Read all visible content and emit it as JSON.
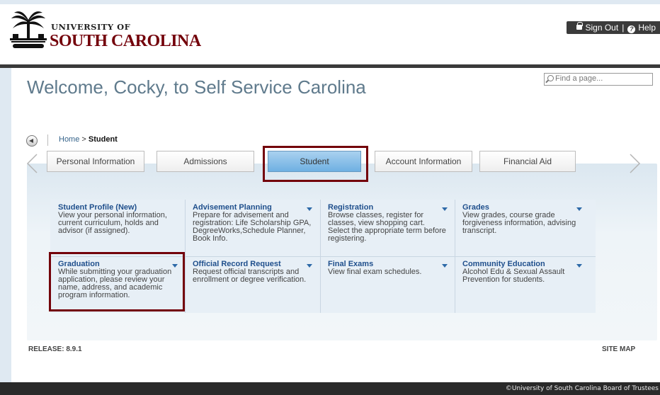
{
  "header": {
    "logo_line1": "UNIVERSITY OF",
    "logo_line2": "SOUTH CAROLINA",
    "sign_out": "Sign Out",
    "separator": "|",
    "help": "Help",
    "icons": [
      "palmetto-seal-icon",
      "lock-icon",
      "help-icon"
    ]
  },
  "page": {
    "welcome": "Welcome, Cocky, to Self Service Carolina",
    "find_placeholder": "Find a page..."
  },
  "breadcrumb": {
    "home": "Home",
    "separator": ">",
    "current": "Student"
  },
  "tabs": [
    {
      "label": "Personal Information"
    },
    {
      "label": "Admissions"
    },
    {
      "label": "Student",
      "active": true
    },
    {
      "label": "Account Information"
    },
    {
      "label": "Financial Aid"
    }
  ],
  "menu": [
    {
      "title": "Student Profile (New)",
      "desc": "View your personal information, current curriculum, holds and advisor (if assigned).",
      "dropdown": false
    },
    {
      "title": "Advisement Planning",
      "desc": "Prepare for advisement and registration: Life Scholarship GPA, DegreeWorks,Schedule Planner, Book Info.",
      "dropdown": true
    },
    {
      "title": "Registration",
      "desc": "Browse classes, register for classes, view shopping cart. Select the appropriate term before registering.",
      "dropdown": true
    },
    {
      "title": "Grades",
      "desc": "View grades, course grade forgiveness information, advising transcript.",
      "dropdown": true
    },
    {
      "title": "Graduation",
      "desc": "While submitting your graduation application, please review your name, address, and academic program information.",
      "dropdown": true
    },
    {
      "title": "Official Record Request",
      "desc": "Request official transcripts and enrollment or degree verification.",
      "dropdown": true
    },
    {
      "title": "Final Exams",
      "desc": "View final exam schedules.",
      "dropdown": true
    },
    {
      "title": "Community Education",
      "desc": "Alcohol Edu & Sexual Assault Prevention for students.",
      "dropdown": true
    }
  ],
  "footer": {
    "release": "RELEASE: 8.9.1",
    "site_map": "SITE MAP",
    "copyright": "©University of South Carolina Board of Trustees"
  },
  "colors": {
    "garnet": "#73000a",
    "link_blue": "#1f4f8c",
    "active_tab": "#6fb0e2",
    "welcome_text": "#5f7a8c"
  }
}
